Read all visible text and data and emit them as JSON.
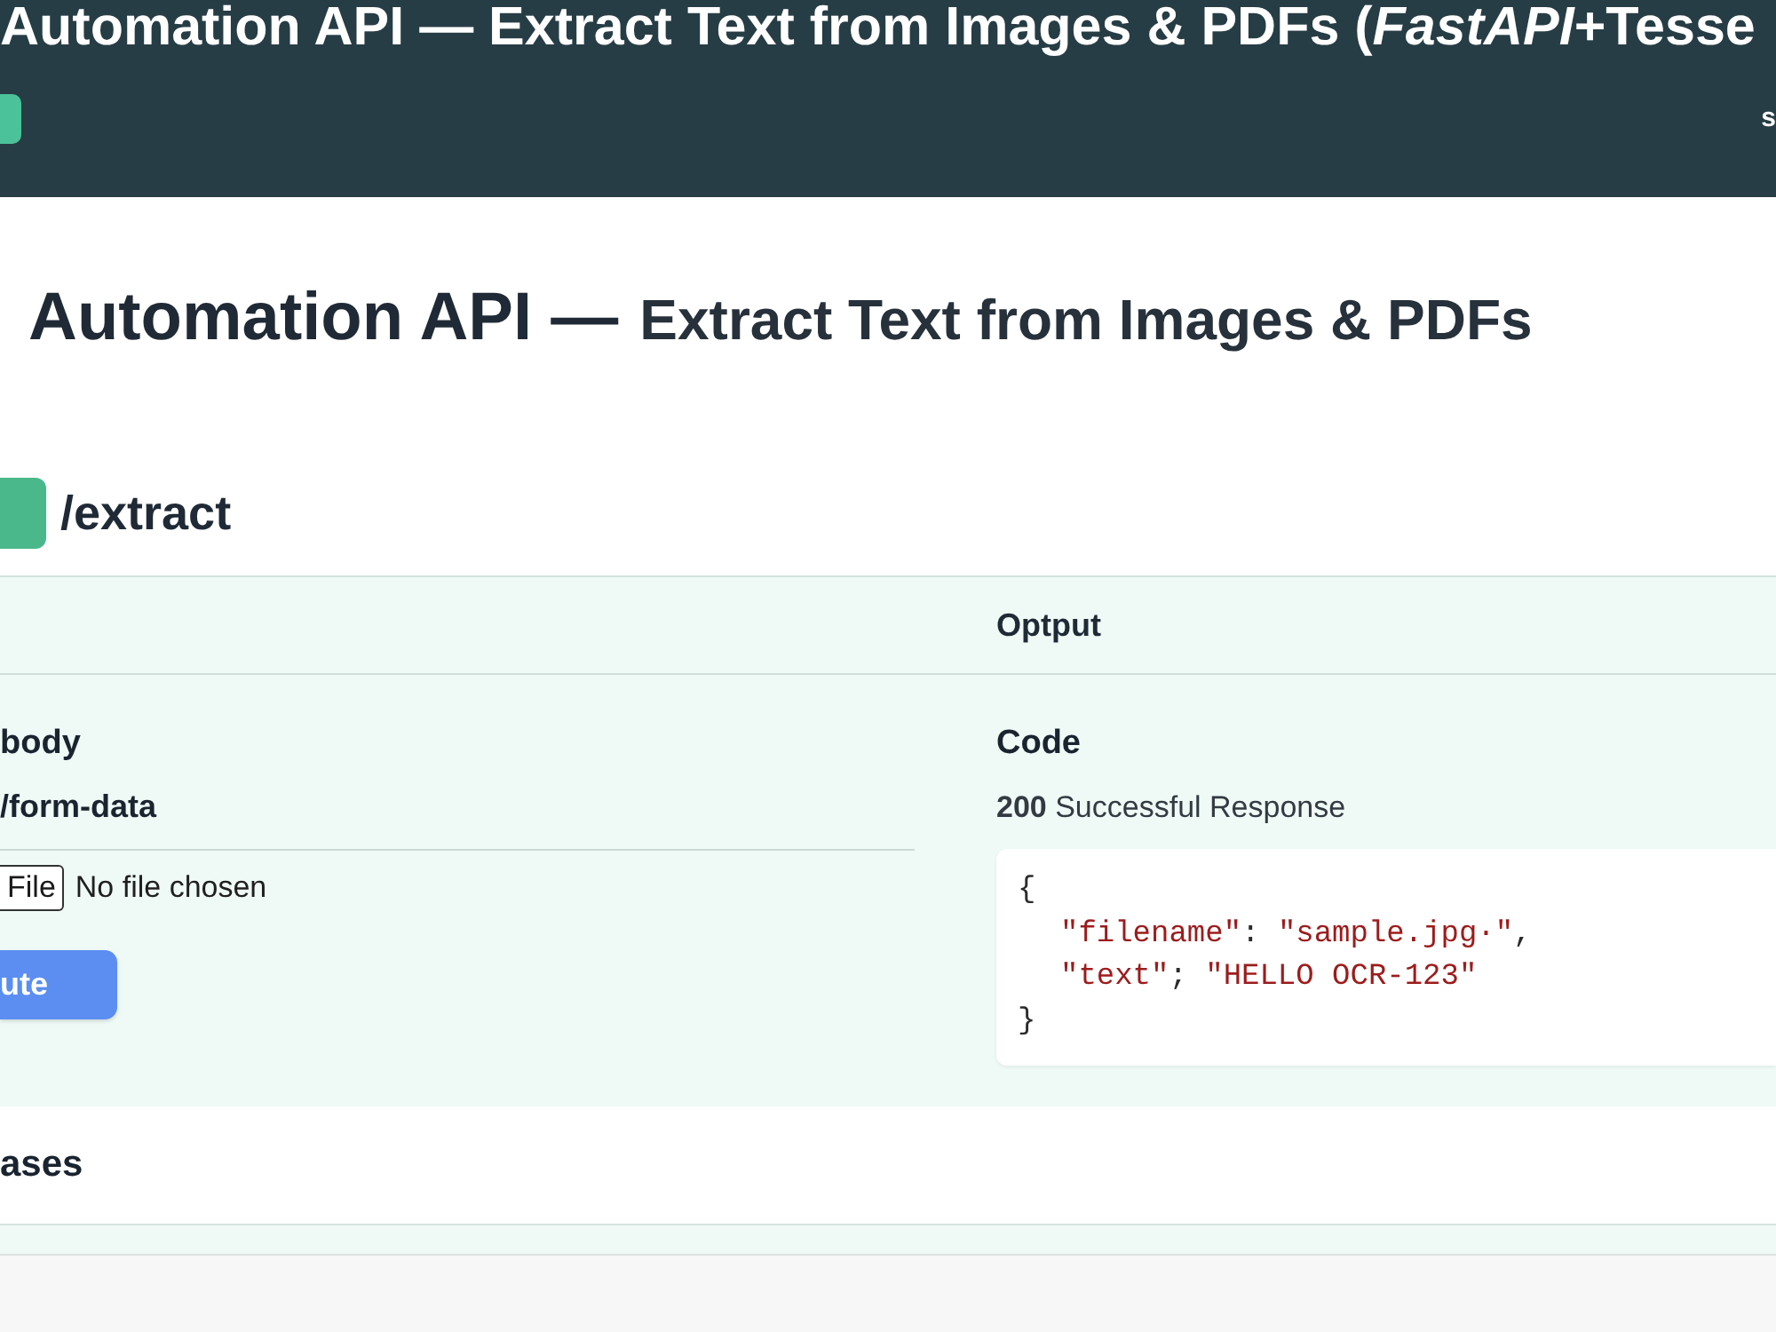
{
  "header": {
    "title": "Automation API — Extract Text from Images & PDFs (*FastAPI*+Tesse",
    "nav_links": [
      "s"
    ]
  },
  "page": {
    "title": "Automation API —",
    "subtitle": "Extract Text from Images & PDFs"
  },
  "endpoint": {
    "path": "/extract"
  },
  "operation": {
    "output_heading": "Optput",
    "request": {
      "heading": "body",
      "content_type": "/form-data",
      "file_input": {
        "button": "File",
        "status": "No file chosen"
      },
      "execute_button": "ute"
    },
    "response": {
      "heading": "Code",
      "status": "**200** Successful Response",
      "body": {
        "open": "{",
        "entries": [
          {
            "key": "\"filename\"",
            "separator": ":",
            "value": "\"sample.jpg·\"",
            "trailing": ","
          },
          {
            "key": "\"text\"",
            "separator": ";",
            "value": "\"HELLO OCR-123\""
          }
        ],
        "close": "}"
      }
    }
  },
  "responses_section": {
    "title": "ases"
  }
}
